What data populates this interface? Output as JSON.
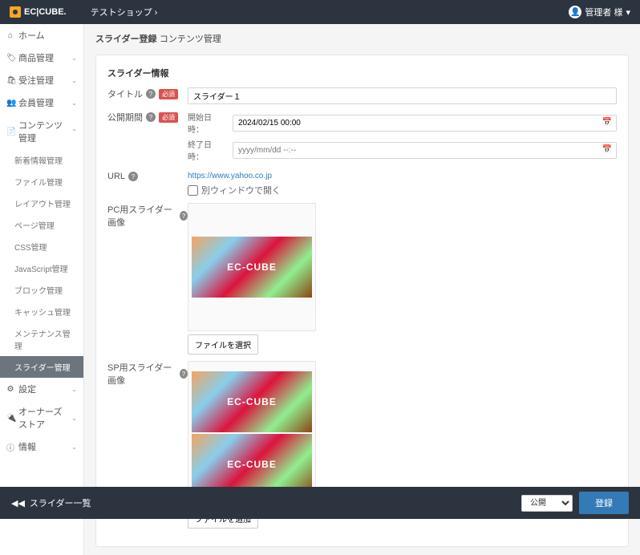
{
  "header": {
    "brand": "EC|CUBE.",
    "shop": "テストショップ",
    "user": "管理者 様"
  },
  "nav": {
    "home": "ホーム",
    "product": "商品管理",
    "order": "受注管理",
    "member": "会員管理",
    "content": "コンテンツ管理",
    "sub": {
      "news": "新着情報管理",
      "file": "ファイル管理",
      "layout": "レイアウト管理",
      "page": "ページ管理",
      "css": "CSS管理",
      "js": "JavaScript管理",
      "block": "ブロック管理",
      "cache": "キャッシュ管理",
      "maint": "メンテナンス管理",
      "slider": "スライダー管理"
    },
    "setting": "設定",
    "owner": "オーナーズストア",
    "info": "情報"
  },
  "crumb": {
    "title": "スライダー登録",
    "section": "コンテンツ管理"
  },
  "sec": "スライダー情報",
  "labels": {
    "title": "タイトル",
    "period": "公開期間",
    "url": "URL",
    "pc": "PC用スライダー画像",
    "sp": "SP用スライダー画像",
    "req": "必須",
    "start": "開始日時：",
    "end": "終了日時："
  },
  "values": {
    "title": "スライダー１",
    "start": "2024/02/15 00:00",
    "end_ph": "yyyy/mm/dd --:--",
    "url": "https://www.yahoo.co.jp",
    "newwin": "別ウィンドウで開く",
    "thumb": "EC-CUBE"
  },
  "btns": {
    "file": "ファイルを選択",
    "fileadd": "ファイルを追加",
    "back": "スライダー一覧",
    "vis": "公開",
    "submit": "登録"
  }
}
